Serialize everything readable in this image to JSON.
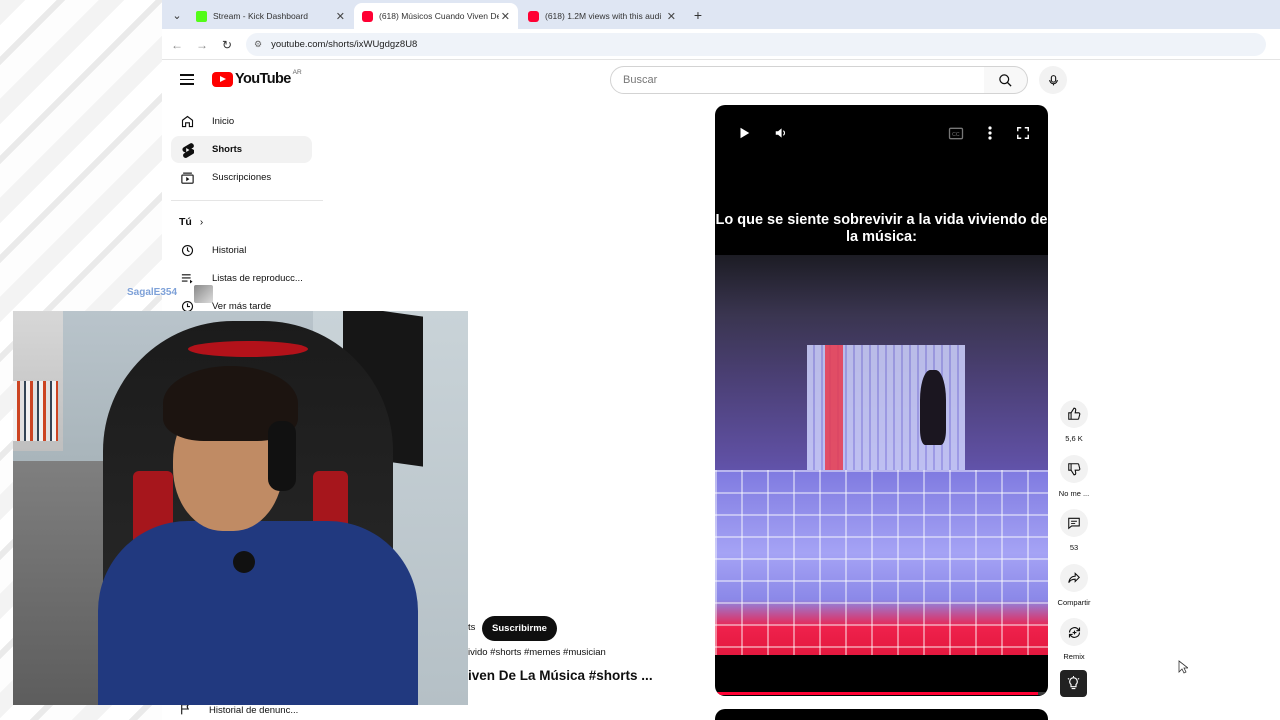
{
  "browser": {
    "tabs": [
      {
        "title": "Stream - Kick Dashboard",
        "favicon": "kick-icon",
        "active": false
      },
      {
        "title": "(618) Músicos Cuando Viven De",
        "favicon": "youtube-icon",
        "active": true
      },
      {
        "title": "(618) 1.2M views with this audi",
        "favicon": "youtube-icon",
        "active": false
      }
    ],
    "url": "youtube.com/shorts/ixWUgdgz8U8"
  },
  "youtube": {
    "logo_text": "YouTube",
    "country_code": "AR",
    "search_placeholder": "Buscar"
  },
  "sidebar": {
    "items": [
      {
        "label": "Inicio",
        "icon": "home-icon"
      },
      {
        "label": "Shorts",
        "icon": "shorts-icon",
        "active": true
      },
      {
        "label": "Suscripciones",
        "icon": "subscriptions-icon"
      }
    ],
    "you_section": {
      "title": "Tú"
    },
    "you_items": [
      {
        "label": "Historial",
        "icon": "history-icon"
      },
      {
        "label": "Listas de reproducc...",
        "icon": "playlist-icon"
      },
      {
        "label": "Ver más tarde",
        "icon": "clock-icon"
      }
    ],
    "bottom_item": {
      "label": "Historial de denunc...",
      "icon": "flag-icon"
    }
  },
  "stream_overlay": {
    "username": "SagalE354"
  },
  "video": {
    "caption": "Lo que se siente sobrevivir a la vida viviendo de la música:",
    "progress": 0.97
  },
  "channel": {
    "name_suffix": "ts",
    "subscribe_label": "Suscribirme",
    "tags": "ivido #shorts #memes #musician",
    "title": "iven De La Música #shorts ..."
  },
  "actions": {
    "like_count": "5,6 K",
    "dislike_label": "No me ...",
    "comment_count": "53",
    "share_label": "Compartir",
    "remix_label": "Remix"
  }
}
